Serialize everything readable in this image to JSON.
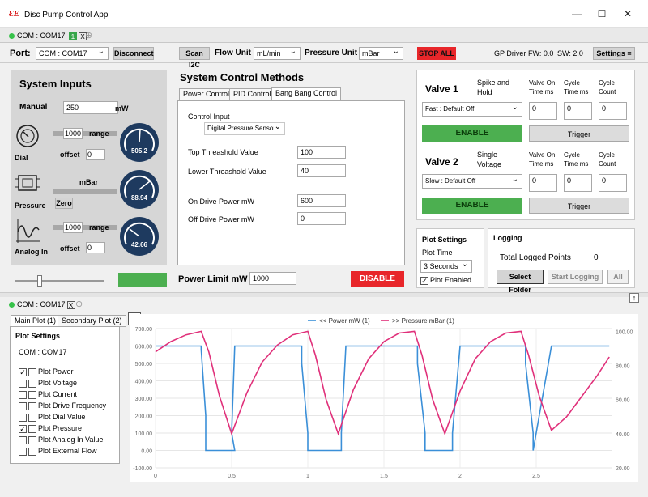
{
  "app": {
    "title": "Disc Pump Control App"
  },
  "device_tab": {
    "label": "COM : COM17",
    "badge": "1",
    "close": "X"
  },
  "toolbar": {
    "port_label": "Port:",
    "port_value": "COM : COM17",
    "disconnect_label": "Disconnect",
    "scan_label": "Scan I2C",
    "flow_unit_label": "Flow Unit",
    "flow_unit_value": "mL/min",
    "pressure_unit_label": "Pressure Unit",
    "pressure_unit_value": "mBar",
    "stop_all_label": "STOP ALL",
    "gp_driver": "GP Driver",
    "fw": "FW: 0.0",
    "sw": "SW: 2.0",
    "settings_label": "Settings"
  },
  "system_inputs": {
    "title": "System Inputs",
    "manual_label": "Manual",
    "manual_value": "250",
    "manual_unit": "mW",
    "dial_label": "Dial",
    "dial_range_value": "1000",
    "dial_range_label": "range",
    "dial_offset_label": "offset",
    "dial_offset_value": "0",
    "dial_gauge_value": "505.2",
    "pressure_label": "Pressure",
    "pressure_unit": "mBar",
    "zero_label": "Zero",
    "pressure_gauge_value": "88.94",
    "analog_label": "Analog In",
    "analog_range_value": "1000",
    "analog_range_label": "range",
    "analog_offset_label": "offset",
    "analog_offset_value": "0",
    "analog_gauge_value": "42.66"
  },
  "control_methods": {
    "title": "System Control Methods",
    "tabs": [
      "Power Control",
      "PID Control",
      "Bang Bang Control"
    ],
    "control_input_label": "Control Input",
    "control_input_value": "Digital Pressure Sensor",
    "top_threshold_label": "Top Threashold Value",
    "top_threshold_value": "100",
    "lower_threshold_label": "Lower Threashold Value",
    "lower_threshold_value": "40",
    "on_drive_label": "On Drive Power mW",
    "on_drive_value": "600",
    "off_drive_label": "Off Drive Power mW",
    "off_drive_value": "0",
    "power_limit_label": "Power Limit mW",
    "power_limit_value": "1000",
    "disable_label": "DISABLE"
  },
  "valves": [
    {
      "title": "Valve 1",
      "mode_line1": "Spike and",
      "mode_line2": "Hold",
      "on_time_label1": "Valve On",
      "on_time_label2": "Time ms",
      "cycle_time_label1": "Cycle",
      "cycle_time_label2": "Time ms",
      "cycle_count_label1": "Cycle",
      "cycle_count_label2": "Count",
      "preset": "Fast : Default Off",
      "on_time": "0",
      "cycle_time": "0",
      "cycle_count": "0",
      "enable_label": "ENABLE",
      "trigger_label": "Trigger"
    },
    {
      "title": "Valve 2",
      "mode_line1": "Single",
      "mode_line2": "Voltage",
      "on_time_label1": "Valve On",
      "on_time_label2": "Time ms",
      "cycle_time_label1": "Cycle",
      "cycle_time_label2": "Time ms",
      "cycle_count_label1": "Cycle",
      "cycle_count_label2": "Count",
      "preset": "Slow : Default Off",
      "on_time": "0",
      "cycle_time": "0",
      "cycle_count": "0",
      "enable_label": "ENABLE",
      "trigger_label": "Trigger"
    }
  ],
  "plot_settings": {
    "title": "Plot Settings",
    "plot_time_label": "Plot Time",
    "plot_time_value": "3 Seconds",
    "plot_enabled_label": "Plot Enabled"
  },
  "logging": {
    "title": "Logging",
    "total_label": "Total Logged Points",
    "total_value": "0",
    "select_folder_label": "Select Folder",
    "start_logging_label": "Start Logging",
    "all_label": "All"
  },
  "lower": {
    "device_tab_label": "COM : COM17",
    "device_tab_close": "X",
    "collapse_arrow": "⇐",
    "restore": "↑",
    "tabs": [
      "Main Plot (1)",
      "Secondary Plot (2)"
    ],
    "settings_title": "Plot Settings",
    "device_label": "COM : COM17",
    "items": [
      {
        "label": "Plot Power",
        "checked": true
      },
      {
        "label": "Plot Voltage",
        "checked": false
      },
      {
        "label": "Plot Current",
        "checked": false
      },
      {
        "label": "Plot Drive Frequency",
        "checked": false
      },
      {
        "label": "Plot Dial Value",
        "checked": false
      },
      {
        "label": "Plot Pressure",
        "checked": true
      },
      {
        "label": "Plot Analog In Value",
        "checked": false
      },
      {
        "label": "Plot External Flow",
        "checked": false
      }
    ]
  },
  "colors": {
    "power": "#3a8fd8",
    "pressure": "#e0307a",
    "stop": "#e8262a",
    "enable": "#4caf50",
    "gauge": "#1e3a5f"
  },
  "chart_data": {
    "type": "line",
    "legend": [
      "<< Power mW (1)",
      ">> Pressure mBar (1)"
    ],
    "x_ticks": [
      "0",
      "0.5",
      "1",
      "1.5",
      "2",
      "2.5"
    ],
    "y_left_ticks": [
      "700.00",
      "600.00",
      "500.00",
      "400.00",
      "300.00",
      "200.00",
      "100.00",
      "0.00",
      "-100.00"
    ],
    "y_right_ticks": [
      "100.00",
      "80.00",
      "60.00",
      "40.00",
      "20.00"
    ],
    "xlim": [
      0,
      3
    ],
    "ylim_left": [
      -100,
      700
    ],
    "ylim_right": [
      20,
      100
    ],
    "series": [
      {
        "name": "<< Power mW (1)",
        "axis": "left",
        "x": [
          0,
          0.3,
          0.3,
          0.33,
          0.33,
          0.5,
          0.52,
          0.5,
          0.52,
          0.55,
          0.8,
          0.96,
          0.96,
          1.0,
          1.0,
          1.17,
          1.22,
          1.22,
          1.25,
          1.25,
          1.48,
          1.72,
          1.72,
          1.77,
          1.77,
          1.9,
          1.95,
          1.95,
          2.0,
          2.0,
          2.3,
          2.43,
          2.43,
          2.48,
          2.48,
          2.6,
          2.98
        ],
        "y": [
          600,
          600,
          580,
          200,
          0,
          0,
          0,
          100,
          600,
          600,
          600,
          600,
          500,
          100,
          0,
          0,
          0,
          100,
          600,
          600,
          600,
          600,
          500,
          100,
          0,
          0,
          0,
          100,
          600,
          600,
          600,
          600,
          500,
          100,
          0,
          600,
          600
        ]
      },
      {
        "name": ">> Pressure mBar (1)",
        "axis": "right",
        "x": [
          0,
          0.1,
          0.2,
          0.3,
          0.35,
          0.42,
          0.5,
          0.6,
          0.7,
          0.8,
          0.9,
          1.0,
          1.05,
          1.12,
          1.2,
          1.3,
          1.4,
          1.5,
          1.6,
          1.7,
          1.75,
          1.82,
          1.9,
          2.0,
          2.1,
          2.2,
          2.3,
          2.4,
          2.45,
          2.52,
          2.6,
          2.7,
          2.8,
          2.9,
          2.98
        ],
        "y": [
          88,
          94,
          98,
          100,
          88,
          62,
          40,
          64,
          82,
          92,
          98,
          100,
          86,
          60,
          40,
          66,
          84,
          94,
          99,
          100,
          86,
          60,
          40,
          65,
          84,
          94,
          99,
          100,
          86,
          62,
          42,
          50,
          62,
          74,
          85
        ]
      }
    ]
  }
}
